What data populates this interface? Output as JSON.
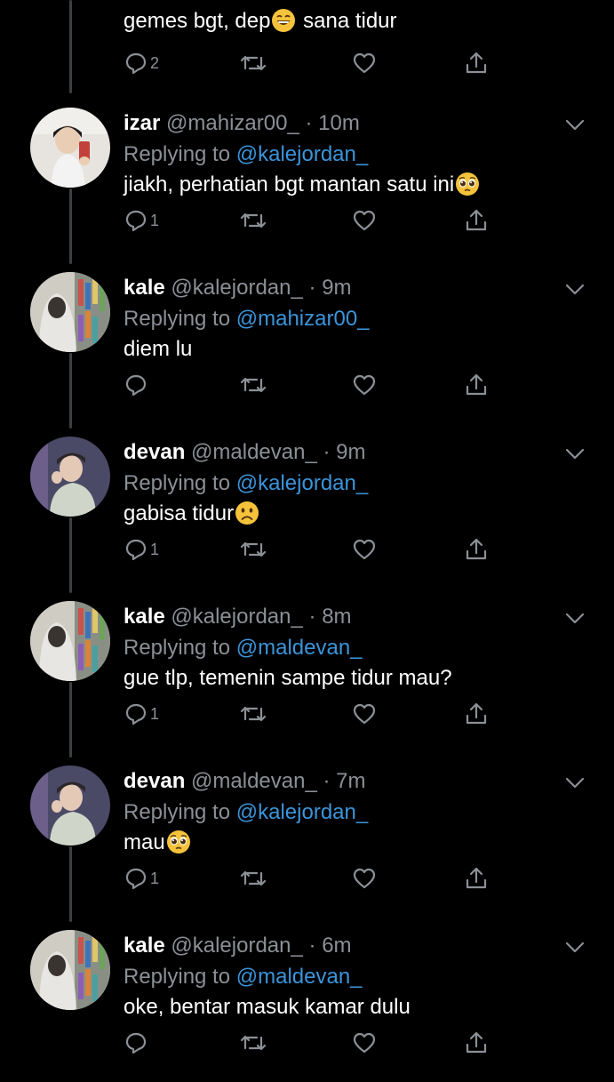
{
  "top_tweet": {
    "text": "gemes bgt, dep",
    "text_after": " sana tidur",
    "emoji": "grin-emoji",
    "reply_count": "2"
  },
  "tweets": [
    {
      "name": "izar",
      "handle": "@mahizar00_",
      "dot": "·",
      "time": "10m",
      "replying_prefix": "Replying to ",
      "replying_to": "@kalejordan_",
      "text": "jiakh, perhatian bgt mantan satu ini",
      "emoji": "pleading-face-emoji",
      "reply_count": "1"
    },
    {
      "name": "kale",
      "handle": "@kalejordan_",
      "dot": "·",
      "time": "9m",
      "replying_prefix": "Replying to ",
      "replying_to": "@mahizar00_",
      "text": "diem lu",
      "emoji": "",
      "reply_count": ""
    },
    {
      "name": "devan",
      "handle": "@maldevan_",
      "dot": "·",
      "time": "9m",
      "replying_prefix": "Replying to ",
      "replying_to": "@kalejordan_",
      "text": "gabisa tidur",
      "emoji": "slightly-frowning-emoji",
      "reply_count": "1"
    },
    {
      "name": "kale",
      "handle": "@kalejordan_",
      "dot": "·",
      "time": "8m",
      "replying_prefix": "Replying to ",
      "replying_to": "@maldevan_",
      "text": "gue tlp, temenin sampe tidur mau?",
      "emoji": "",
      "reply_count": "1"
    },
    {
      "name": "devan",
      "handle": "@maldevan_",
      "dot": "·",
      "time": "7m",
      "replying_prefix": "Replying to ",
      "replying_to": "@kalejordan_",
      "text": "mau",
      "emoji": "pleading-face-emoji",
      "reply_count": "1"
    },
    {
      "name": "kale",
      "handle": "@kalejordan_",
      "dot": "·",
      "time": "6m",
      "replying_prefix": "Replying to ",
      "replying_to": "@maldevan_",
      "text": "oke, bentar masuk kamar dulu",
      "emoji": "",
      "reply_count": ""
    }
  ],
  "colors": {
    "background": "#000000",
    "text": "#ffffff",
    "muted": "#8b9096",
    "link": "#3b94d9",
    "thread_line": "#3c3f42",
    "emoji_yellow": "#f5c33b"
  }
}
